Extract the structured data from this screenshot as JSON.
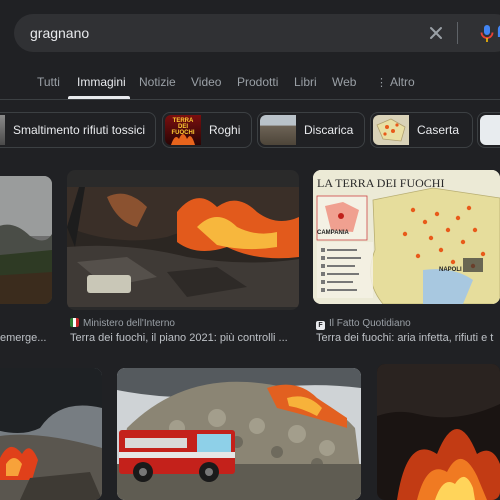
{
  "search": {
    "query": "gragnano"
  },
  "tabs": [
    {
      "label": "Tutti"
    },
    {
      "label": "Immagini"
    },
    {
      "label": "Notizie"
    },
    {
      "label": "Video"
    },
    {
      "label": "Prodotti"
    },
    {
      "label": "Libri"
    },
    {
      "label": "Web"
    },
    {
      "label": "Altro"
    }
  ],
  "chips": [
    {
      "label": "Smaltimento rifiuti tossici"
    },
    {
      "label": "Roghi",
      "thumb_text": "TERRA DEI FUOCHI"
    },
    {
      "label": "Discarica"
    },
    {
      "label": "Caserta"
    }
  ],
  "results": [
    {
      "caption": "emerge..."
    },
    {
      "source": "Ministero dell'Interno",
      "caption": "Terra dei fuochi, il piano 2021: più controlli ..."
    },
    {
      "source": "Il Fatto Quotidiano",
      "caption": "Terra dei fuochi: aria infetta, rifiuti e t"
    }
  ],
  "map_image": {
    "title": "LA TERRA DEI FUOCHI",
    "region": "CAMPANIA",
    "city": "NAPOLI"
  },
  "colors": {
    "background": "#202124",
    "search_bg": "#303134",
    "accent_blue": "#8ab4f8",
    "mic_blue": "#4285f4",
    "text": "#e8eaed",
    "muted": "#9aa0a6"
  }
}
